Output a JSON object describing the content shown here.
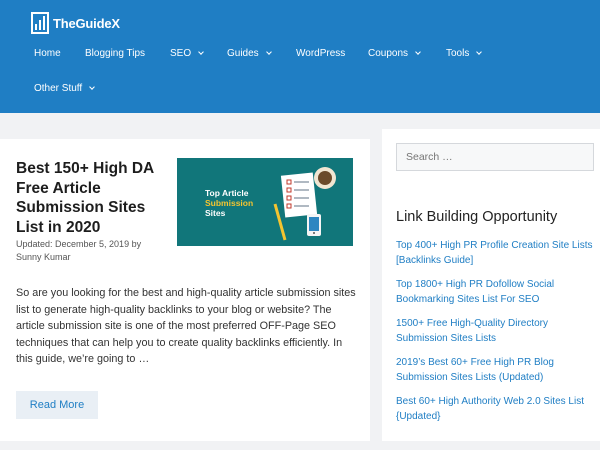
{
  "header": {
    "logo_text": "TheGuideX",
    "nav": [
      {
        "label": "Home"
      },
      {
        "label": "Blogging Tips"
      },
      {
        "label": "SEO"
      },
      {
        "label": "Guides"
      },
      {
        "label": "WordPress"
      },
      {
        "label": "Coupons"
      },
      {
        "label": "Tools"
      },
      {
        "label": "Other Stuff"
      }
    ]
  },
  "post": {
    "title": "Best 150+ High DA Free Article Submission Sites List in 2020",
    "meta": "Updated: December 5, 2019 by Sunny Kumar",
    "thumbnail": {
      "line1": "Top Article",
      "line2": "Submission",
      "line3": "Sites"
    },
    "excerpt": "So are you looking for the best and high-quality article submission sites list to generate high-quality backlinks to your blog or website? The article submission site is one of the most preferred OFF-Page SEO techniques that can help you to create quality backlinks efficiently. In this guide, we’re going to …",
    "read_more": "Read More"
  },
  "sidebar": {
    "search_placeholder": "Search …",
    "widget_title": "Link Building Opportunity",
    "links": [
      "Top 400+ High PR Profile Creation Site Lists [Backlinks Guide]",
      "Top 1800+ High PR Dofollow Social Bookmarking Sites List For SEO",
      "1500+ Free High-Quality Directory Submission Sites Lists",
      "2019’s Best 60+ Free High PR Blog Submission Sites Lists (Updated)",
      "Best 60+ High Authority Web 2.0 Sites List {Updated}"
    ]
  },
  "colors": {
    "header_bg": "#1f7ec4",
    "link": "#1f7ec4",
    "thumb_bg": "#11767a"
  }
}
